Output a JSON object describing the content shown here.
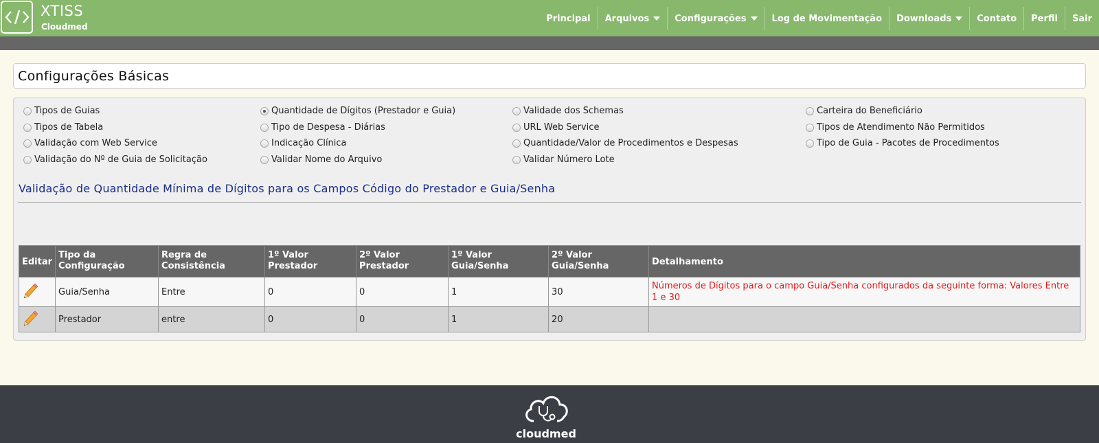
{
  "brand": {
    "title": "XTISS",
    "subtitle": "Cloudmed"
  },
  "nav": [
    {
      "label": "Principal",
      "dropdown": false
    },
    {
      "label": "Arquivos",
      "dropdown": true
    },
    {
      "label": "Configurações",
      "dropdown": true
    },
    {
      "label": "Log de Movimentação",
      "dropdown": false
    },
    {
      "label": "Downloads",
      "dropdown": true
    },
    {
      "label": "Contato",
      "dropdown": false
    },
    {
      "label": "Perfil",
      "dropdown": false
    },
    {
      "label": "Sair",
      "dropdown": false
    }
  ],
  "page_title": "Configurações Básicas",
  "options": [
    {
      "label": "Tipos de Guias",
      "checked": false
    },
    {
      "label": "Quantidade de Dígitos (Prestador e Guia)",
      "checked": true
    },
    {
      "label": "Validade dos Schemas",
      "checked": false
    },
    {
      "label": "Carteira do Beneficiário",
      "checked": false
    },
    {
      "label": "Tipos de Tabela",
      "checked": false
    },
    {
      "label": "Tipo de Despesa - Diárias",
      "checked": false
    },
    {
      "label": "URL Web Service",
      "checked": false
    },
    {
      "label": "Tipos de Atendimento Não Permitidos",
      "checked": false
    },
    {
      "label": "Validação com Web Service",
      "checked": false
    },
    {
      "label": "Indicação Clínica",
      "checked": false
    },
    {
      "label": "Quantidade/Valor de Procedimentos e Despesas",
      "checked": false
    },
    {
      "label": "Tipo de Guia - Pacotes de Procedimentos",
      "checked": false
    },
    {
      "label": "Validação do Nº de Guia de Solicitação",
      "checked": false
    },
    {
      "label": "Validar Nome do Arquivo",
      "checked": false
    },
    {
      "label": "Validar Número Lote",
      "checked": false
    }
  ],
  "section_title": "Validação de Quantidade Mínima de Dígitos para os Campos Código do Prestador e Guia/Senha",
  "table": {
    "headers": [
      "Editar",
      "Tipo da Configuração",
      "Regra de Consistência",
      "1º Valor Prestador",
      "2º Valor Prestador",
      "1º Valor Guia/Senha",
      "2º Valor Guia/Senha",
      "Detalhamento"
    ],
    "rows": [
      {
        "tipo": "Guia/Senha",
        "regra": "Entre",
        "v1_prestador": "0",
        "v2_prestador": "0",
        "v1_guia": "1",
        "v2_guia": "30",
        "detalhamento": "Números de Dígitos para o campo Guia/Senha configurados da seguinte forma: Valores Entre 1 e 30"
      },
      {
        "tipo": "Prestador",
        "regra": "entre",
        "v1_prestador": "0",
        "v2_prestador": "0",
        "v1_guia": "1",
        "v2_guia": "20",
        "detalhamento": ""
      }
    ]
  },
  "footer": {
    "logo_text": "cloudmed"
  },
  "colors": {
    "header": "#87b86c",
    "subbar": "#666666",
    "section_title": "#1a2f8a",
    "detail_red": "#e01b1b",
    "footer": "#3b3e44"
  }
}
